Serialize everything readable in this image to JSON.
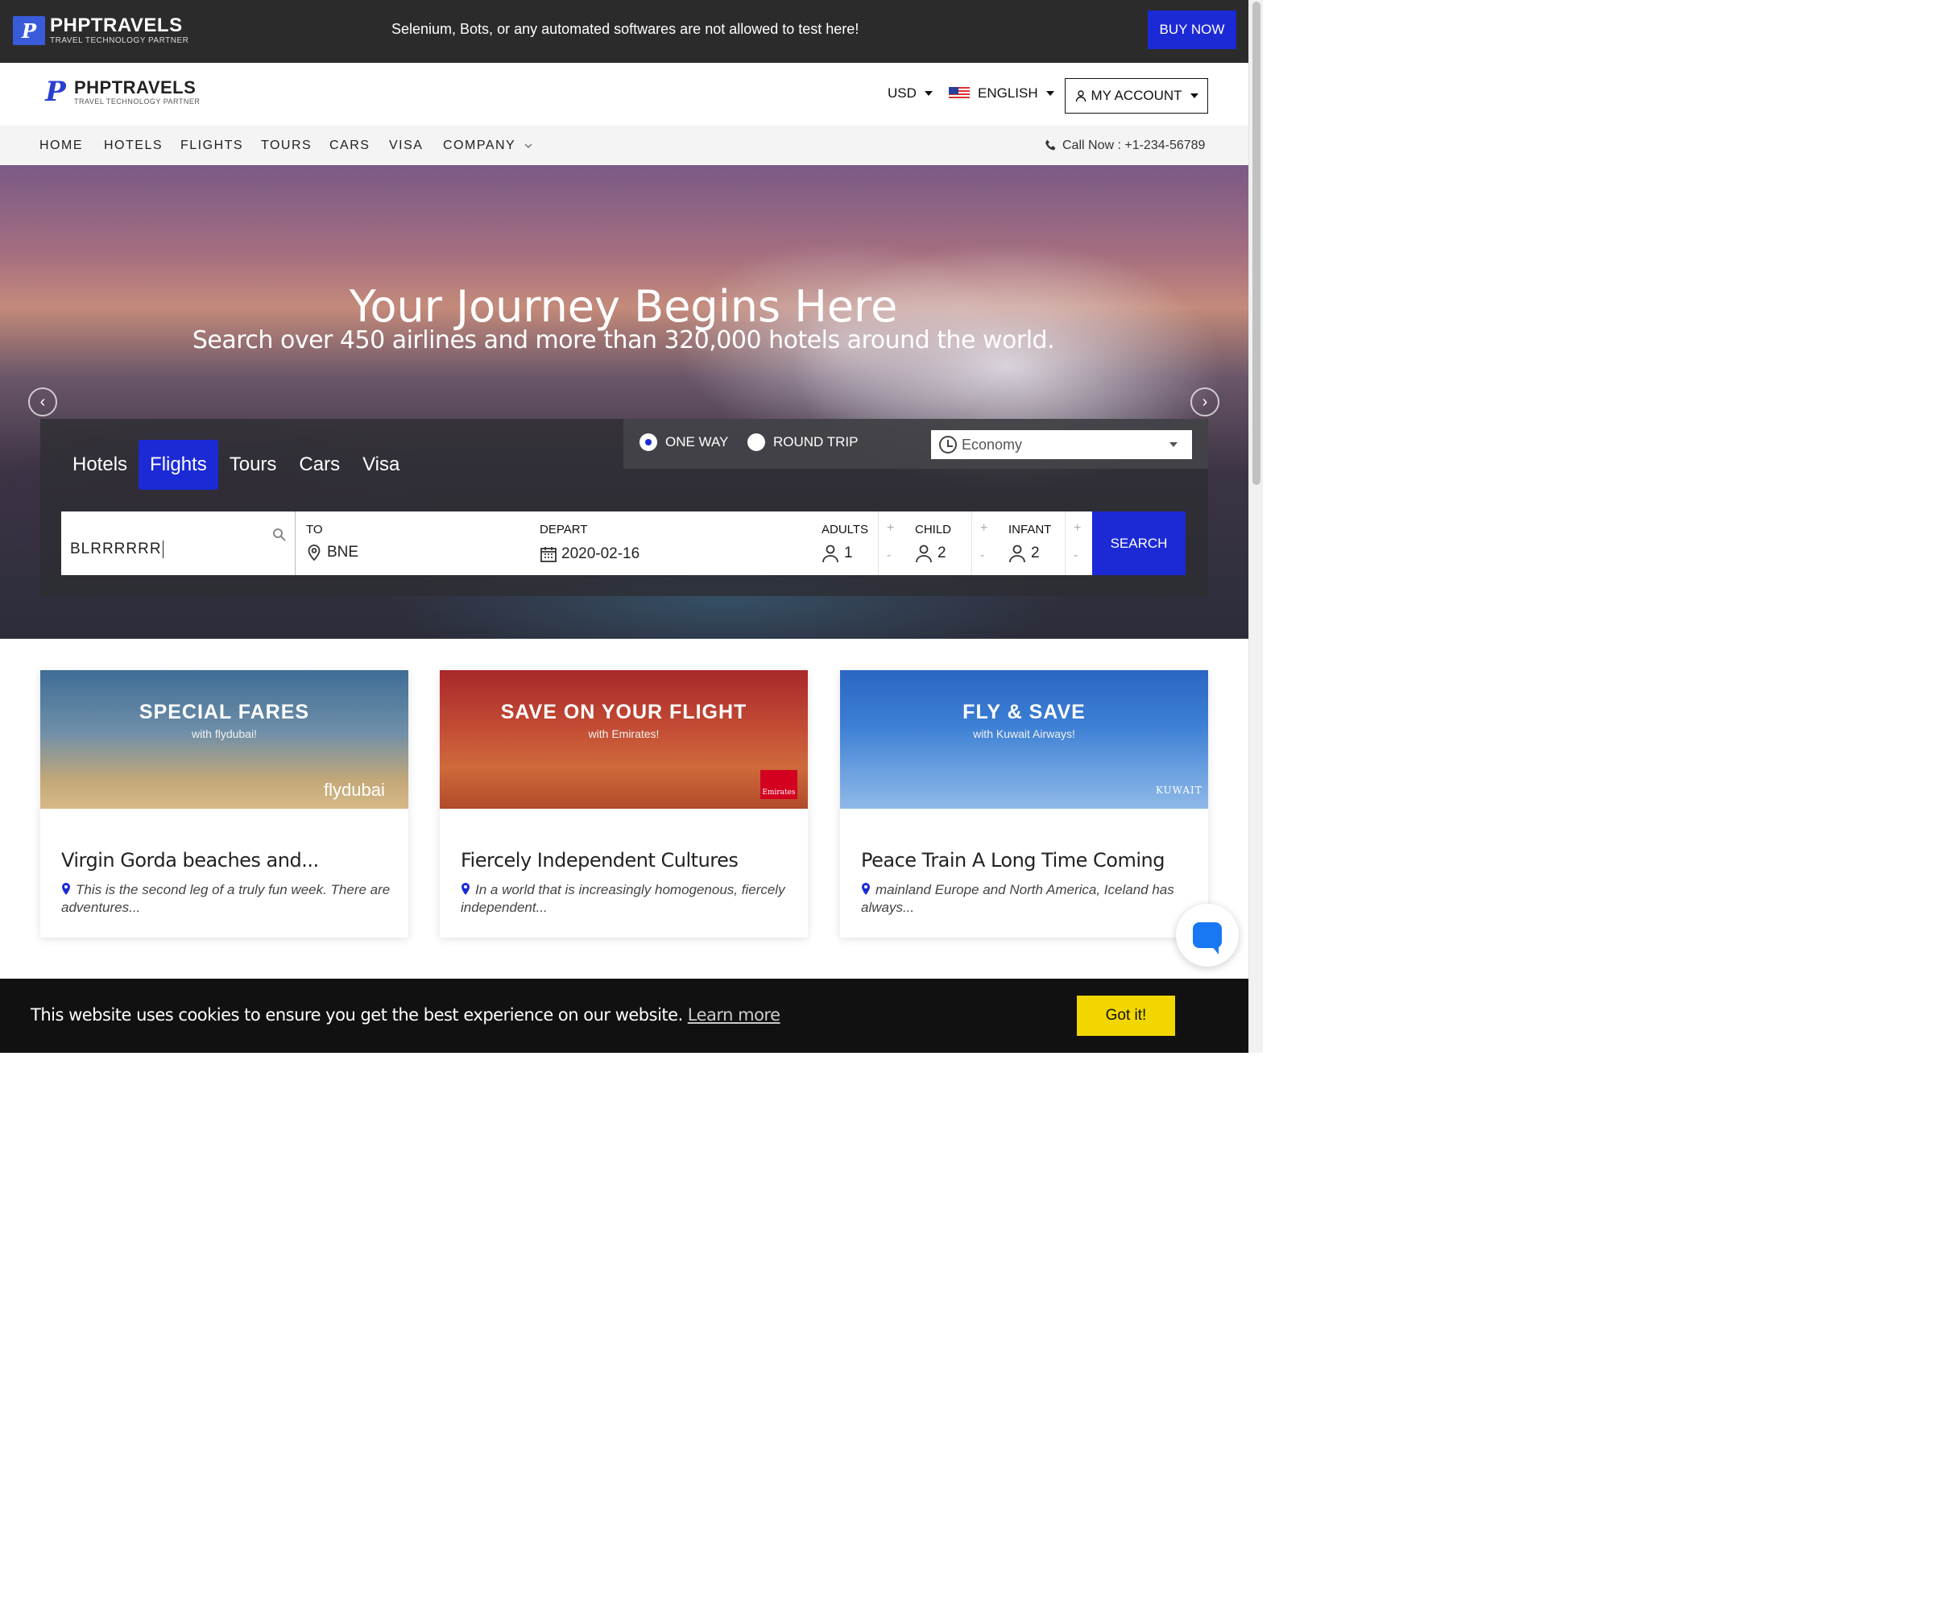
{
  "topbar": {
    "brand_name": "PHPTRAVELS",
    "brand_tagline": "TRAVEL TECHNOLOGY PARTNER",
    "warning": "Selenium, Bots, or any automated softwares are not allowed to test here!",
    "buy_now": "BUY NOW"
  },
  "header": {
    "brand_name": "PHPTRAVELS",
    "brand_tagline": "TRAVEL TECHNOLOGY PARTNER",
    "currency": "USD",
    "language": "ENGLISH",
    "account": "MY ACCOUNT"
  },
  "nav": {
    "items": [
      "HOME",
      "HOTELS",
      "FLIGHTS",
      "TOURS",
      "CARS",
      "VISA",
      "COMPANY"
    ],
    "call": "Call Now : +1-234-56789"
  },
  "hero": {
    "title": "Your Journey Begins Here",
    "subtitle": "Search over 450 airlines and more than 320,000 hotels around the world."
  },
  "search": {
    "tabs": [
      "Hotels",
      "Flights",
      "Tours",
      "Cars",
      "Visa"
    ],
    "active_tab": "Flights",
    "trip_types": [
      "ONE WAY",
      "ROUND TRIP"
    ],
    "selected_trip": "ONE WAY",
    "cabin": "Economy",
    "from_value": "BLRRRRRR",
    "to_label": "TO",
    "to_value": "BNE",
    "depart_label": "DEPART",
    "depart_value": "2020-02-16",
    "adults_label": "ADULTS",
    "adults_value": "1",
    "child_label": "CHILD",
    "child_value": "2",
    "infant_label": "INFANT",
    "infant_value": "2",
    "plus": "+",
    "minus": "-",
    "search_button": "SEARCH"
  },
  "cards": [
    {
      "banner_title": "SPECIAL FARES",
      "banner_sub": "with flydubai!",
      "banner_brand": "flydubai",
      "title": "Virgin Gorda beaches and...",
      "desc": "This is the second leg of a truly fun week. There are adventures..."
    },
    {
      "banner_title": "SAVE ON YOUR FLIGHT",
      "banner_sub": "with Emirates!",
      "banner_brand": "Emirates",
      "title": "Fiercely Independent Cultures",
      "desc": "In a world that is increasingly homogenous, fiercely independent..."
    },
    {
      "banner_title": "FLY & SAVE",
      "banner_sub": "with Kuwait Airways!",
      "banner_brand": "KUWAIT",
      "title": "Peace Train A Long Time Coming",
      "desc": "mainland Europe and North America, Iceland has always..."
    }
  ],
  "cookie": {
    "message": "This website uses cookies to ensure you get the best experience on our website.",
    "learn_more": "Learn more",
    "got_it": "Got it!"
  },
  "colors": {
    "accent": "#1c2ad6",
    "topbar": "#2b2b2b",
    "cookie_button": "#f1d600"
  }
}
